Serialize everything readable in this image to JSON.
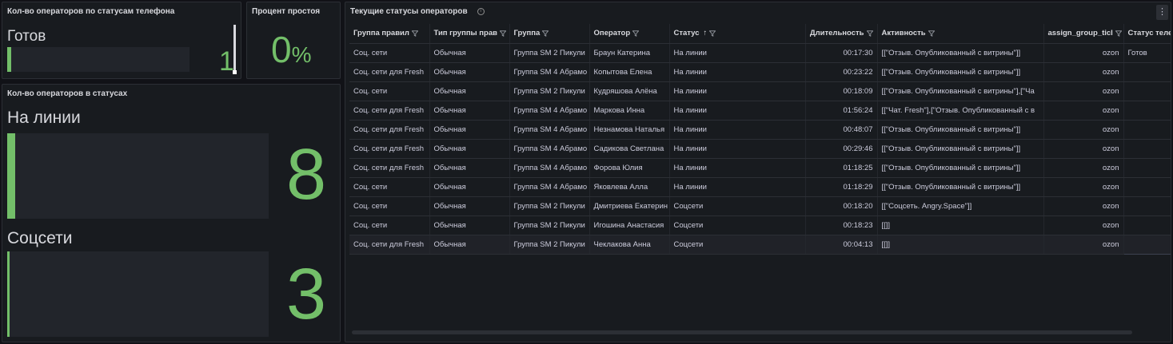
{
  "panel_phone": {
    "title": "Кол-во операторов по статусам телефона",
    "label": "Готов",
    "value": "1",
    "fraction": 0.02
  },
  "panel_idle": {
    "title": "Процент простоя",
    "value": "0",
    "unit": "%"
  },
  "panel_statuses": {
    "title": "Кол-во операторов в статусах",
    "items": [
      {
        "label": "На линии",
        "value": "8",
        "fraction": 0.03
      },
      {
        "label": "Соцсети",
        "value": "3",
        "fraction": 0.01
      }
    ]
  },
  "panel_table": {
    "title": "Текущие статусы операторов",
    "info_icon": "info-icon",
    "menu_icon": "kebab-menu-icon",
    "columns": [
      "Группа правил",
      "Тип группы прав",
      "Группа",
      "Оператор",
      "Статус",
      "Длительность",
      "Активность",
      "assign_group_ticl",
      "Статус теле"
    ],
    "sort_indicator": "↑",
    "rows": [
      [
        "Соц. сети",
        "Обычная",
        "Группа SM 2 Пикули",
        "Браун Катерина",
        "На линии",
        "00:17:30",
        "[[\"Отзыв. Опубликованный с витрины\"]]",
        "ozon",
        "Готов"
      ],
      [
        "Соц. сети для Fresh",
        "Обычная",
        "Группа SM 4 Абрамо",
        "Копытова Елена",
        "На линии",
        "00:23:22",
        "[[\"Отзыв. Опубликованный с витрины\"]]",
        "ozon",
        ""
      ],
      [
        "Соц. сети",
        "Обычная",
        "Группа SM 2 Пикули",
        "Кудряшова Алёна",
        "На линии",
        "00:18:09",
        "[[\"Отзыв. Опубликованный с витрины\"],[\"Ча",
        "ozon",
        ""
      ],
      [
        "Соц. сети для Fresh",
        "Обычная",
        "Группа SM 4 Абрамо",
        "Маркова Инна",
        "На линии",
        "01:56:24",
        "[[\"Чат. Fresh\"],[\"Отзыв. Опубликованный с в",
        "ozon",
        ""
      ],
      [
        "Соц. сети для Fresh",
        "Обычная",
        "Группа SM 4 Абрамо",
        "Незнамова Наталья",
        "На линии",
        "00:48:07",
        "[[\"Отзыв. Опубликованный с витрины\"]]",
        "ozon",
        ""
      ],
      [
        "Соц. сети для Fresh",
        "Обычная",
        "Группа SM 4 Абрамо",
        "Садикова Светлана",
        "На линии",
        "00:29:46",
        "[[\"Отзыв. Опубликованный с витрины\"]]",
        "ozon",
        ""
      ],
      [
        "Соц. сети для Fresh",
        "Обычная",
        "Группа SM 4 Абрамо",
        "Форова Юлия",
        "На линии",
        "01:18:25",
        "[[\"Отзыв. Опубликованный с витрины\"]]",
        "ozon",
        ""
      ],
      [
        "Соц. сети",
        "Обычная",
        "Группа SM 4 Абрамо",
        "Яковлева Алла",
        "На линии",
        "01:18:29",
        "[[\"Отзыв. Опубликованный с витрины\"]]",
        "ozon",
        ""
      ],
      [
        "Соц. сети",
        "Обычная",
        "Группа SM 2 Пикули",
        "Дмитриева Екатерин",
        "Соцсети",
        "00:18:20",
        "[[\"Соцсеть. Angry.Space\"]]",
        "ozon",
        ""
      ],
      [
        "Соц. сети",
        "Обычная",
        "Группа SM 2 Пикули",
        "Игошина Анастасия",
        "Соцсети",
        "00:18:23",
        "[[]]",
        "ozon",
        ""
      ],
      [
        "Соц. сети для Fresh",
        "Обычная",
        "Группа SM 2 Пикули",
        "Чеклакова Анна",
        "Соцсети",
        "00:04:13",
        "[[]]",
        "ozon",
        ""
      ]
    ]
  }
}
